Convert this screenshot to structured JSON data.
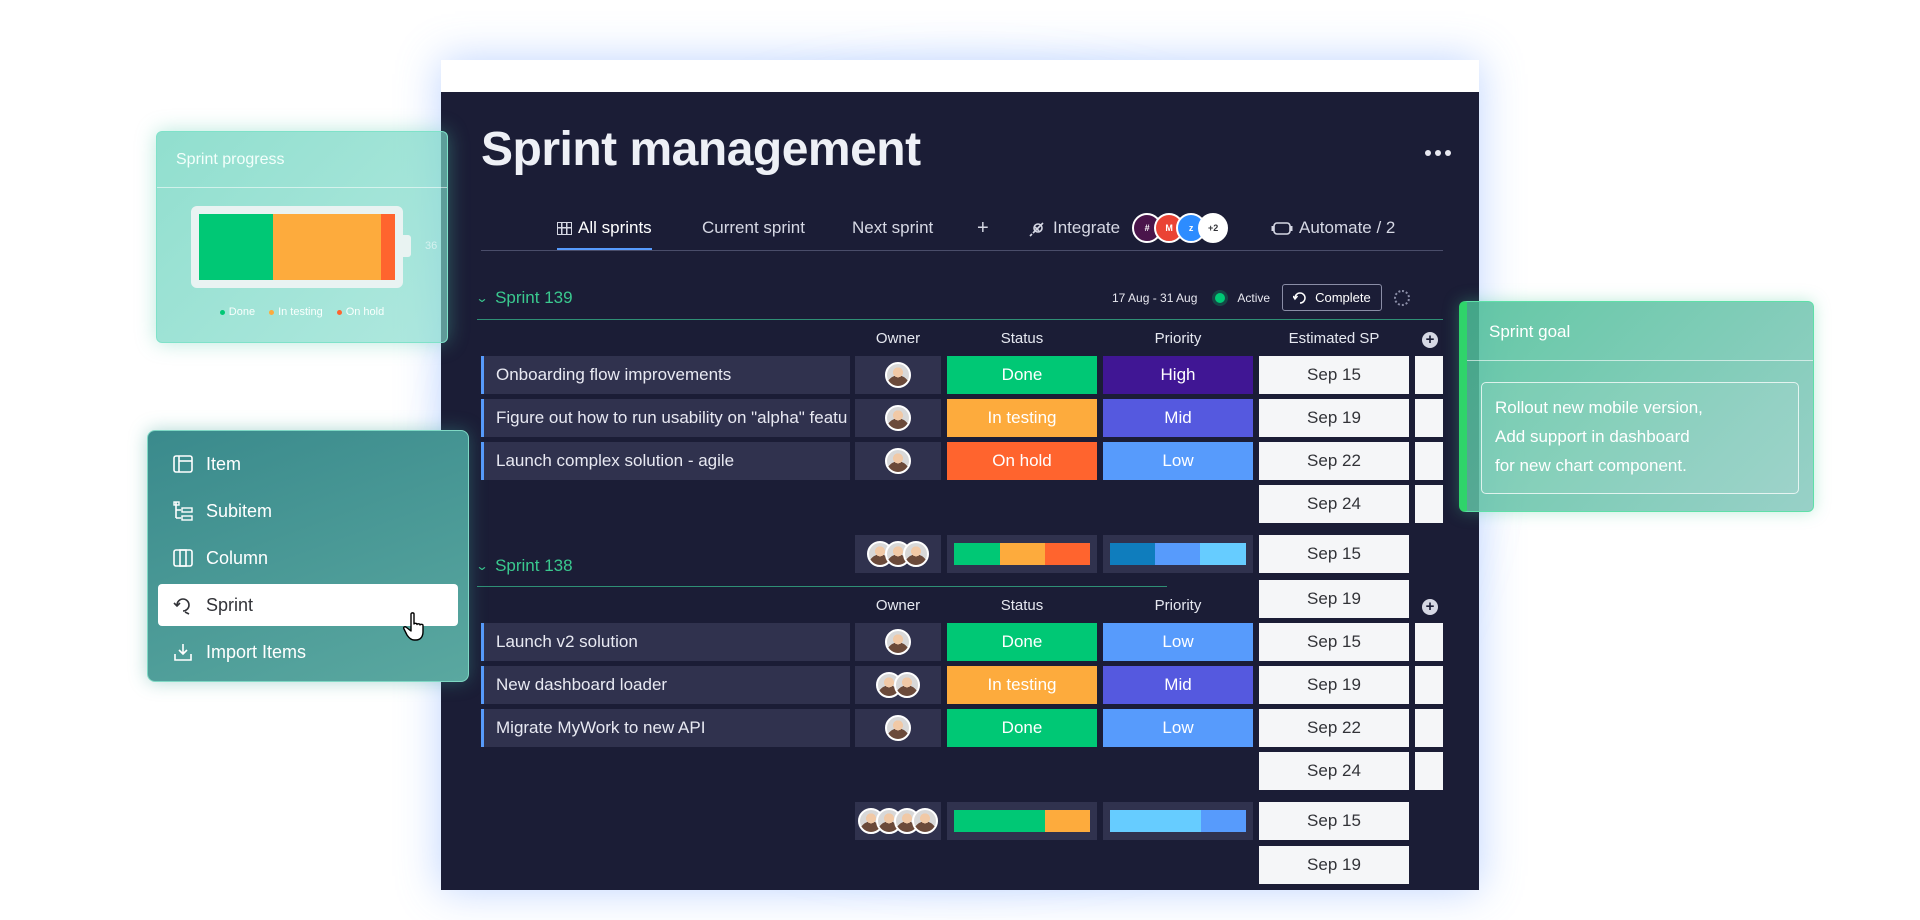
{
  "board": {
    "title": "Sprint management",
    "tabs": [
      {
        "label": "All sprints",
        "active": true
      },
      {
        "label": "Current sprint"
      },
      {
        "label": "Next sprint"
      }
    ],
    "add_tab": "+",
    "integrate_label": "Integrate",
    "integrate_more": "+2",
    "automate_label": "Automate / 2"
  },
  "columns": {
    "owner": "Owner",
    "status": "Status",
    "priority": "Priority",
    "estimated": "Estimated SP"
  },
  "sprints": [
    {
      "name": "Sprint 139",
      "date_range": "17 Aug - 31 Aug",
      "state": "Active",
      "complete_label": "Complete",
      "rows": [
        {
          "name": "Onboarding flow improvements",
          "status": "Done",
          "status_color": "#00c875",
          "priority": "High",
          "priority_color": "#401694",
          "date": "Sep 15"
        },
        {
          "name": "Figure out how to run usability on \"alpha\" featu",
          "status": "In testing",
          "status_color": "#fdab3d",
          "priority": "Mid",
          "priority_color": "#5559df",
          "date": "Sep 19"
        },
        {
          "name": "Launch complex solution - agile",
          "status": "On hold",
          "status_color": "#ff642e",
          "priority": "Low",
          "priority_color": "#579bfc",
          "date": "Sep 22"
        }
      ],
      "extra_dates": [
        "Sep 24"
      ],
      "summary_dates": [
        "Sep 15",
        "Sep 19"
      ]
    },
    {
      "name": "Sprint 138",
      "rows": [
        {
          "name": "Launch v2 solution",
          "status": "Done",
          "status_color": "#00c875",
          "priority": "Low",
          "priority_color": "#579bfc",
          "date": "Sep 15"
        },
        {
          "name": "New dashboard loader",
          "status": "In testing",
          "status_color": "#fdab3d",
          "priority": "Mid",
          "priority_color": "#5559df",
          "date": "Sep 19"
        },
        {
          "name": "Migrate MyWork to new API",
          "status": "Done",
          "status_color": "#00c875",
          "priority": "Low",
          "priority_color": "#579bfc",
          "date": "Sep 22"
        }
      ],
      "extra_dates": [
        "Sep 24"
      ],
      "summary_dates": [
        "Sep 15",
        "Sep 19"
      ]
    }
  ],
  "sprint_progress": {
    "title": "Sprint progress",
    "percent_label": "36",
    "segments": [
      {
        "label": "Done",
        "fraction": 0.38,
        "color": "#00c875"
      },
      {
        "label": "In testing",
        "fraction": 0.55,
        "color": "#fdab3d"
      },
      {
        "label": "On hold",
        "fraction": 0.07,
        "color": "#ff642e"
      }
    ]
  },
  "add_menu": {
    "items": [
      {
        "label": "Item",
        "icon": "item-icon"
      },
      {
        "label": "Subitem",
        "icon": "subitem-icon"
      },
      {
        "label": "Column",
        "icon": "column-icon"
      },
      {
        "label": "Sprint",
        "icon": "sprint-icon",
        "selected": true
      },
      {
        "label": "Import Items",
        "icon": "import-icon"
      }
    ]
  },
  "sprint_goal": {
    "title": "Sprint goal",
    "lines": [
      "Rollout new mobile version,",
      "Add support in dashboard",
      "for new chart component."
    ]
  },
  "colors": {
    "board_bg": "#1b1d36",
    "accent": "#579bfc",
    "group_green": "#3ac98f",
    "done": "#00c875",
    "in_testing": "#fdab3d",
    "on_hold": "#ff642e"
  }
}
